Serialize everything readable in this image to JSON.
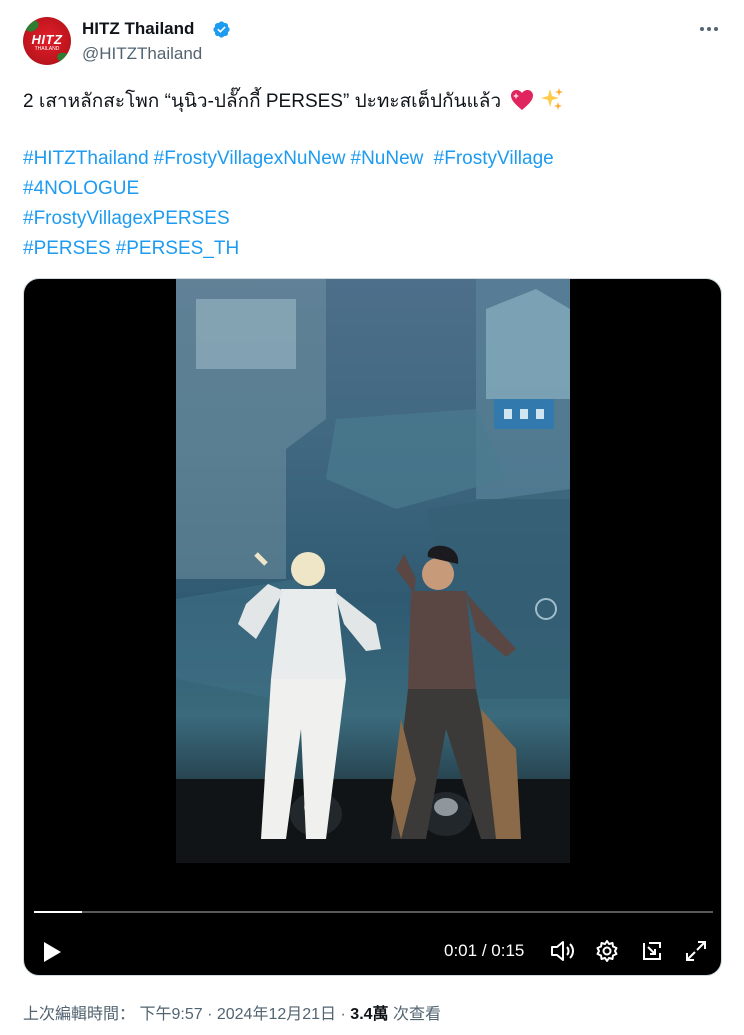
{
  "author": {
    "display_name": "HITZ Thailand",
    "handle": "@HITZThailand",
    "avatar_logo": "HITZ",
    "avatar_sub": "THAILAND",
    "verified": true
  },
  "tweet": {
    "text": "2 เสาหลักสะโพก “นุนิว-ปลั๊กกี้ PERSES” ปะทะสเต็ปกันแล้ว",
    "emojis": [
      "sparkling-heart",
      "sparkles"
    ],
    "hashtag_lines": [
      [
        "#HITZThailand",
        "#FrostyVillagexNuNew",
        "#NuNew",
        "#FrostyVillage"
      ],
      [
        "#4NOLOGUE"
      ],
      [
        "#FrostyVillagexPERSES"
      ],
      [
        "#PERSES",
        "#PERSES_TH"
      ]
    ]
  },
  "video": {
    "current_time": "0:01",
    "duration": "0:15",
    "progress_percent": 7,
    "controls": [
      "play-icon",
      "volume-icon",
      "settings-icon",
      "dock-icon",
      "fullscreen-icon"
    ]
  },
  "meta": {
    "edited_label": "上次編輯時間：",
    "time": "下午9:57",
    "date": "2024年12月21日",
    "views_count": "3.4萬",
    "views_label": "次查看",
    "separator": "·"
  },
  "colors": {
    "link": "#1d9bf0",
    "secondary_text": "#536471",
    "primary_text": "#0f1419",
    "verified": "#1d9bf0"
  }
}
